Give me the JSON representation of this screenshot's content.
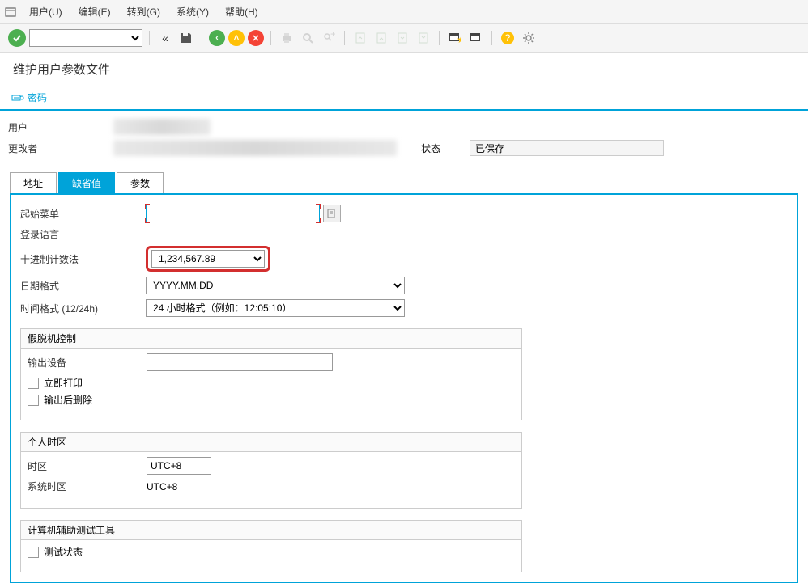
{
  "menu": [
    "用户(U)",
    "编辑(E)",
    "转到(G)",
    "系统(Y)",
    "帮助(H)"
  ],
  "page_title": "维护用户参数文件",
  "password_btn": "密码",
  "header": {
    "user_label": "用户",
    "changer_label": "更改者",
    "status_label": "状态",
    "status_value": "已保存"
  },
  "tabs": [
    "地址",
    "缺省值",
    "参数"
  ],
  "defaults": {
    "start_menu_label": "起始菜单",
    "login_lang_label": "登录语言",
    "decimal_label": "十进制计数法",
    "decimal_value": "1,234,567.89",
    "date_label": "日期格式",
    "date_value": "YYYY.MM.DD",
    "time_label": "时间格式 (12/24h)",
    "time_value": "24 小时格式（例如：12:05:10）"
  },
  "spool": {
    "title": "假脱机控制",
    "output_device_label": "输出设备",
    "print_now": "立即打印",
    "delete_after": "输出后删除"
  },
  "timezone": {
    "title": "个人时区",
    "tz_label": "时区",
    "tz_value": "UTC+8",
    "sys_tz_label": "系统时区",
    "sys_tz_value": "UTC+8"
  },
  "catt": {
    "title": "计算机辅助测试工具",
    "test_status": "测试状态"
  }
}
